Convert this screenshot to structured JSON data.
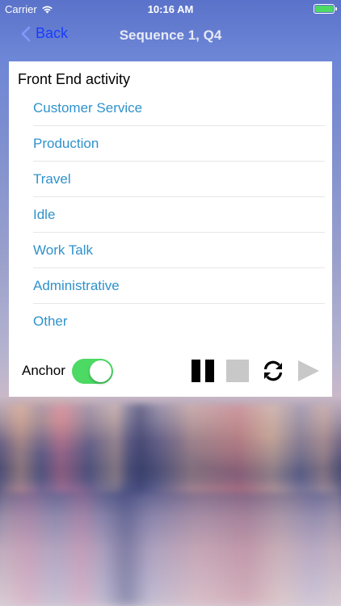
{
  "status_bar": {
    "carrier": "Carrier",
    "time": "10:16 AM",
    "wifi_icon": "wifi-icon",
    "battery_icon": "battery-icon"
  },
  "nav": {
    "back_label": "Back",
    "title": "Sequence 1, Q4",
    "back_color": "#1a3cff"
  },
  "card": {
    "title": "Front End activity",
    "items": [
      "Customer Service",
      "Production",
      "Travel",
      "Idle",
      "Work Talk",
      "Administrative",
      "Other"
    ],
    "item_color": "#2f92cc"
  },
  "controls": {
    "anchor_label": "Anchor",
    "anchor_on": true,
    "toggle_color": "#4cd964",
    "buttons": [
      "pause-icon",
      "stop-icon",
      "refresh-icon",
      "play-icon"
    ]
  }
}
